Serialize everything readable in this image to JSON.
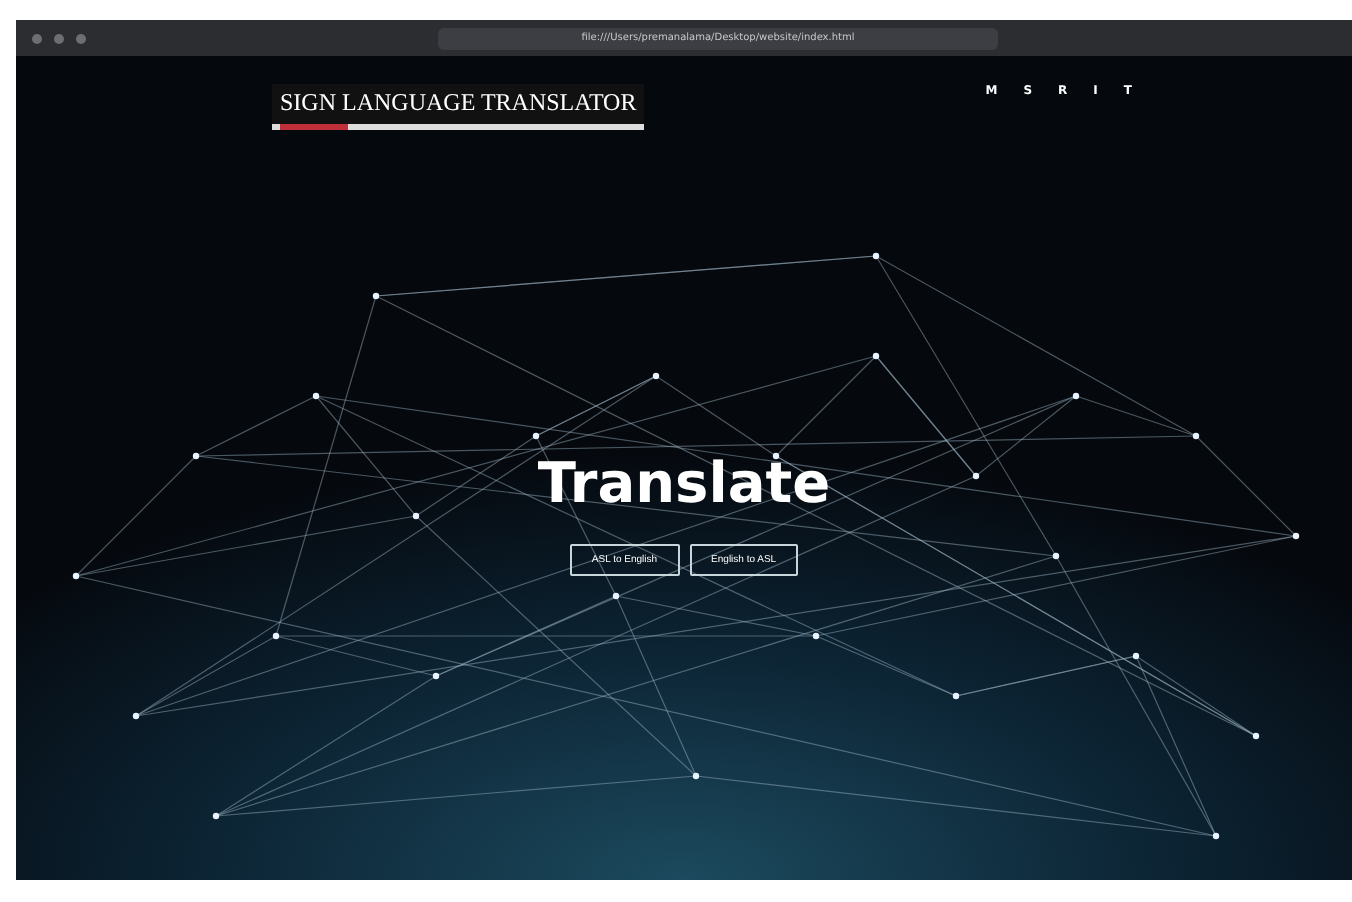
{
  "browser": {
    "url": "file:///Users/premanalama/Desktop/website/index.html"
  },
  "header": {
    "logo": "SIGN LANGUAGE TRANSLATOR",
    "nav": [
      "M",
      "S",
      "R",
      "I",
      "T"
    ]
  },
  "hero": {
    "title": "Translate",
    "buttons": [
      "ASL to English",
      "English to ASL"
    ]
  }
}
